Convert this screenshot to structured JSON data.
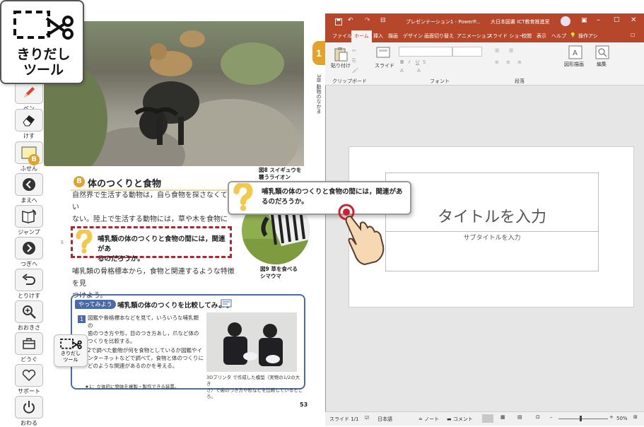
{
  "toolbar": {
    "items": [
      {
        "label": "ペン",
        "icon": "pen-icon"
      },
      {
        "label": "けす",
        "icon": "eraser-icon"
      },
      {
        "label": "ふせん",
        "icon": "sticky-note-icon"
      },
      {
        "label": "まえへ",
        "icon": "chevron-left-icon"
      },
      {
        "label": "ジャンプ",
        "icon": "jump-book-icon"
      },
      {
        "label": "つぎへ",
        "icon": "chevron-right-icon"
      },
      {
        "label": "とりけす",
        "icon": "undo-icon"
      },
      {
        "label": "おおきさ",
        "icon": "zoom-icon"
      },
      {
        "label": "どうぐ",
        "icon": "toolbox-icon"
      },
      {
        "label": "サポート",
        "icon": "heart-icon"
      },
      {
        "label": "おわる",
        "icon": "power-icon"
      }
    ],
    "kiridashi_popup_label": "きりだし\nツール"
  },
  "kiridashi": {
    "label_line1": "きりだし",
    "label_line2": "ツール"
  },
  "book": {
    "chapter_number": "1",
    "chapter_side_text": "3章 動物のなかま",
    "section_badge": "B",
    "section_title": "体のつくりと食物",
    "paragraph1": "自然界で生活する動物は，自ら食物を探さなくてはい\nない。陸上で生活する動物には，草や木を食物にするもの\nや他の動物をとらえて食物とするものがいる。",
    "question": "哺乳類の体のつくりと食物の間には，関連があ\nるのだろうか。",
    "line_number": "5",
    "paragraph2": "哺乳類の骨格標本から，食物と関連するような特徴を見\nつけよう。",
    "fig8_caption": "図8 スイギュウを\n襲うライオン",
    "fig9_caption": "図9 草を食べる\nシマウマ",
    "activity": {
      "tag": "やってみよう",
      "title": "哺乳類の体のつくりを比較してみよう",
      "step1_number": "1",
      "step1": "図鑑や骨格標本などを見て，いろいろな哺乳類の\n歯のつき方や形，目のつき方あし，爪など体の\nつくりを比較する。",
      "step2": "2で調べた動物が何を食物としているか図鑑やイ\nンターネットなどで調べて，食物と体のつくりに\nどのような関連があるのかを考える。",
      "footnote": "★1：立体的に物体を複製・製作できる装置。",
      "photo_caption": "3Dプリンタ で作成した模型（実物の1/2の大き\nさ）で歯のつき方や形などを比較しているところ。"
    },
    "page_number": "53"
  },
  "bubble": {
    "text": "哺乳類の体のつくりと食物の間には，関連があ\nるのだろうか。"
  },
  "ppt": {
    "title": "プレゼンテーション1 - PowerP...",
    "account": "大日本図書 ICT教育推進室",
    "tabs": [
      "ファイル",
      "ホーム",
      "挿入",
      "描画",
      "デザイン",
      "画面切り替え",
      "アニメーション",
      "スライド ショー",
      "校閲",
      "表示",
      "ヘルプ",
      "操作アシ"
    ],
    "active_tab": "ホーム",
    "ribbon": {
      "paste": "貼り付け",
      "slide": "スライド",
      "shapes": "図形描画",
      "edit": "編集",
      "groups": [
        "クリップボード",
        "フォント",
        "段落"
      ]
    },
    "slide": {
      "title_placeholder": "タイトルを入力",
      "subtitle_placeholder": "サブタイトルを入力"
    },
    "status": {
      "slide_counter": "スライド 1/1",
      "language": "日本語",
      "notes": "ノート",
      "comments": "コメント",
      "zoom": "50%"
    }
  },
  "colors": {
    "ppt_red": "#b7472a",
    "chapter_orange": "#e0a32b",
    "question_red": "#a52a35",
    "activity_blue": "#4b6aa6"
  }
}
